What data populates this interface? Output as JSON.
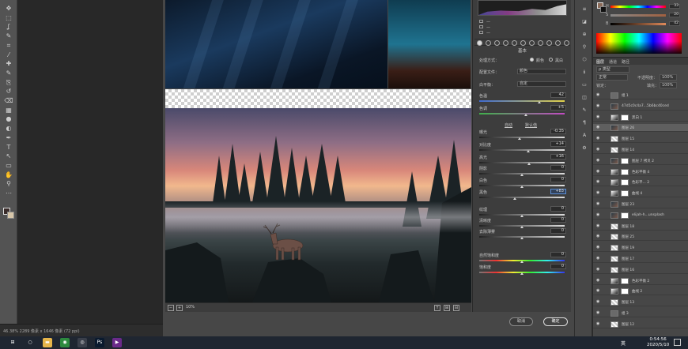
{
  "toolbar": {
    "tools": [
      "move-tool",
      "marquee-tool",
      "lasso-tool",
      "quick-select-tool",
      "crop-tool",
      "eyedropper-tool",
      "healing-tool",
      "brush-tool",
      "clone-stamp-tool",
      "history-brush-tool",
      "eraser-tool",
      "gradient-tool",
      "blur-tool",
      "dodge-tool",
      "pen-tool",
      "type-tool",
      "path-select-tool",
      "shape-tool",
      "hand-tool",
      "zoom-tool",
      "more-tools"
    ],
    "glyphs": [
      "✥",
      "⬚",
      "ʆ",
      "✎",
      "⌗",
      "⁄",
      "✚",
      "✎",
      "⎘",
      "↺",
      "⌫",
      "▦",
      "●",
      "◐",
      "✒",
      "T",
      "↖",
      "▭",
      "✋",
      "⚲",
      "⋯"
    ]
  },
  "status": {
    "text": "46.38%   2289 像素 x 1646 像素 (72 ppi)"
  },
  "preview": {
    "zoom": "10%",
    "buttons": [
      "Y",
      "⊞",
      "⊟"
    ]
  },
  "camera_raw": {
    "meta_rows": [
      "—",
      "—",
      "—"
    ],
    "section_title": "基本",
    "treatment_label": "处理方式：",
    "treatment_color": "颜色",
    "treatment_bw": "黑白",
    "profile_label": "配置文件：",
    "profile_value": "颜色",
    "wb_label": "白平衡：",
    "wb_value": "自定",
    "auto_label": "自动",
    "default_label": "默认值",
    "sliders": [
      {
        "label": "色温",
        "value": "42",
        "pos": 0.7,
        "track": "temp"
      },
      {
        "label": "色调",
        "value": "+5",
        "pos": 0.55,
        "track": "tint"
      },
      {
        "label": "曝光",
        "value": "-0.35",
        "pos": 0.47,
        "track": "gray"
      },
      {
        "label": "对比度",
        "value": "+14",
        "pos": 0.57,
        "track": "gray"
      },
      {
        "label": "高光",
        "value": "+16",
        "pos": 0.58,
        "track": "gray"
      },
      {
        "label": "阴影",
        "value": "0",
        "pos": 0.5,
        "track": "gray"
      },
      {
        "label": "白色",
        "value": "0",
        "pos": 0.5,
        "track": "gray"
      },
      {
        "label": "黑色",
        "value": "+83",
        "pos": 0.42,
        "track": "gray",
        "active": true
      },
      {
        "label": "纹理",
        "value": "0",
        "pos": 0.5,
        "track": "gray"
      },
      {
        "label": "清晰度",
        "value": "0",
        "pos": 0.5,
        "track": "gray"
      },
      {
        "label": "去除薄雾",
        "value": "0",
        "pos": 0.5,
        "track": "gray"
      },
      {
        "label": "自然饱和度",
        "value": "0",
        "pos": 0.5,
        "track": "vib"
      },
      {
        "label": "饱和度",
        "value": "0",
        "pos": 0.5,
        "track": "vib"
      }
    ],
    "cancel_label": "取消",
    "ok_label": "确定"
  },
  "side_strip": {
    "glyphs": [
      "≡",
      "◪",
      "⊕",
      "⚲",
      "⬡",
      "ℹ",
      "▭",
      "◫",
      "✎",
      "¶",
      "A",
      "⚙"
    ]
  },
  "color_panel": {
    "rows": [
      {
        "label": "H",
        "value": "33"
      },
      {
        "label": "S",
        "value": "20"
      },
      {
        "label": "B",
        "value": "42"
      }
    ]
  },
  "layers": {
    "tabs": [
      "图层",
      "通道",
      "路径"
    ],
    "kind_filter": "ρ 类型",
    "blend_mode": "正常",
    "opacity_label": "不透明度：",
    "opacity_value": "100%",
    "lock_label": "锁定：",
    "fill_label": "填充：",
    "fill_value": "100%",
    "items": [
      {
        "name": "组 1",
        "thumb": "folder"
      },
      {
        "name": "47d5c0c4a7...5b6bc40ced",
        "thumb": "photo"
      },
      {
        "name": "黑白 1",
        "thumb": "adj",
        "mask": true
      },
      {
        "name": "图层 26",
        "thumb": "photo",
        "selected": true
      },
      {
        "name": "图层 15",
        "thumb": "check"
      },
      {
        "name": "图层 14",
        "thumb": "check"
      },
      {
        "name": "图层 7 拷贝 2",
        "thumb": "photo",
        "mask": true
      },
      {
        "name": "色彩平衡 4",
        "thumb": "adj",
        "mask": true
      },
      {
        "name": "色彩平... 2",
        "thumb": "adj",
        "mask": true
      },
      {
        "name": "曲线 4",
        "thumb": "adj",
        "mask": true
      },
      {
        "name": "图层 23",
        "thumb": "photo"
      },
      {
        "name": "elijah-h...unsplash",
        "thumb": "photo",
        "mask": true
      },
      {
        "name": "图层 18",
        "thumb": "check"
      },
      {
        "name": "图层 25",
        "thumb": "check"
      },
      {
        "name": "图层 19",
        "thumb": "check"
      },
      {
        "name": "图层 17",
        "thumb": "check"
      },
      {
        "name": "图层 16",
        "thumb": "check"
      },
      {
        "name": "色彩平衡 2",
        "thumb": "adj",
        "mask": true
      },
      {
        "name": "曲线 2",
        "thumb": "adj",
        "mask": true
      },
      {
        "name": "图层 13",
        "thumb": "check"
      },
      {
        "name": "组 3",
        "thumb": "folder"
      },
      {
        "name": "图层 12",
        "thumb": "check"
      }
    ]
  },
  "taskbar": {
    "items": [
      {
        "name": "start-button",
        "glyph": "⊞",
        "color": "#1f2631"
      },
      {
        "name": "search-button",
        "glyph": "○",
        "color": "#1f2631"
      },
      {
        "name": "file-explorer",
        "glyph": "▬",
        "color": "#e6b54a"
      },
      {
        "name": "chrome",
        "glyph": "◉",
        "color": "#2d8a3e"
      },
      {
        "name": "qq-music",
        "glyph": "◎",
        "color": "#3a3f4a"
      },
      {
        "name": "photoshop",
        "glyph": "Ps",
        "color": "#0a1a2e"
      },
      {
        "name": "video-player",
        "glyph": "▶",
        "color": "#6a2a8a"
      }
    ],
    "ime": "英",
    "time": "0:54:56",
    "date": "2020/5/10"
  }
}
